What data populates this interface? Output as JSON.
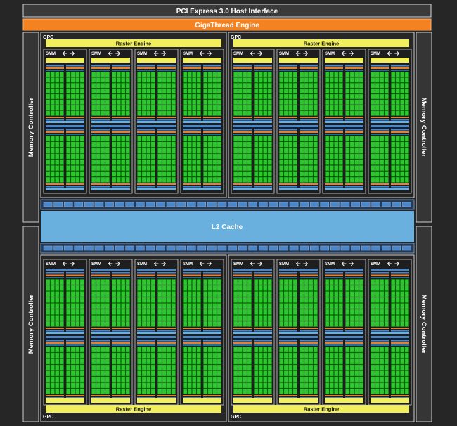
{
  "labels": {
    "pcie": "PCI Express 3.0 Host Interface",
    "gigathread": "GigaThread Engine",
    "memory_controller": "Memory Controller",
    "l2_cache": "L2 Cache",
    "gpc": "GPC",
    "raster_engine": "Raster Engine",
    "smm": "SMM"
  },
  "counts": {
    "memory_controllers": 4,
    "gpcs": 4,
    "smms_per_gpc": 4
  },
  "colors": {
    "background": "#2a2a2a",
    "block_bg": "#333333",
    "border": "#cfcfcf",
    "gigathread": "#f58220",
    "l2_cache": "#6ab0de",
    "raster_engine": "#f2ef5c",
    "core": "#2fc72f",
    "core_dark": "#0d5c0d",
    "blue_unit": "#4a86c8",
    "orange_unit": "#e87f2d",
    "cache_bar": "#6ab0de"
  }
}
